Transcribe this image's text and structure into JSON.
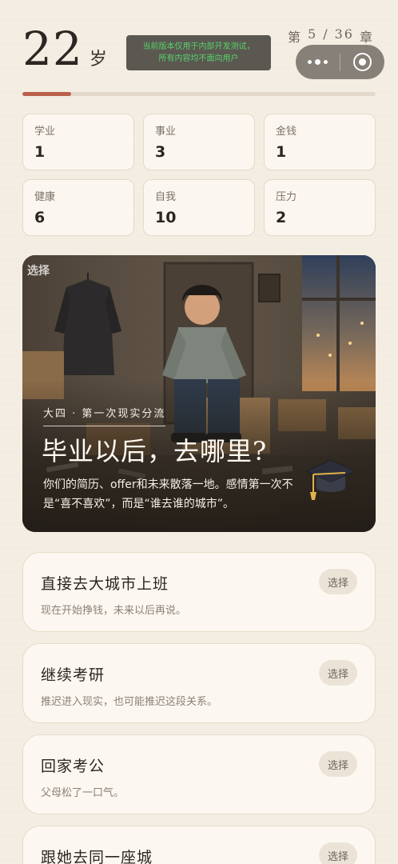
{
  "header": {
    "age": "22",
    "age_unit": "岁",
    "dev_notice_line1": "当前版本仅用于内部开发测试，",
    "dev_notice_line2": "所有内容均不面向用户",
    "chapter_prefix": "第",
    "chapter_current": "5",
    "chapter_sep": "/",
    "chapter_total": "36",
    "chapter_suffix": "章",
    "progress_fraction": 0.1389
  },
  "stats": [
    {
      "label": "学业",
      "value": "1"
    },
    {
      "label": "事业",
      "value": "3"
    },
    {
      "label": "金钱",
      "value": "1"
    },
    {
      "label": "健康",
      "value": "6"
    },
    {
      "label": "自我",
      "value": "10"
    },
    {
      "label": "压力",
      "value": "2"
    }
  ],
  "hero": {
    "badge": "选择",
    "kicker": "大四 · 第一次现实分流",
    "title": "毕业以后，去哪里?",
    "desc": "你们的简历、offer和未来散落一地。感情第一次不是“喜不喜欢”，而是“谁去谁的城市”。",
    "icon": "graduation-cap-icon"
  },
  "choices": [
    {
      "title": "直接去大城市上班",
      "desc": "现在开始挣钱，未来以后再说。",
      "button": "选择"
    },
    {
      "title": "继续考研",
      "desc": "推迟进入现实，也可能推迟这段关系。",
      "button": "选择"
    },
    {
      "title": "回家考公",
      "desc": "父母松了一口气。",
      "button": "选择"
    },
    {
      "title": "跟她去同一座城",
      "desc": "",
      "button": "选择"
    }
  ],
  "colors": {
    "background": "#f3ece1",
    "accent": "#b9604c",
    "card": "#fbf7f0",
    "notice_text": "#55d36a"
  }
}
